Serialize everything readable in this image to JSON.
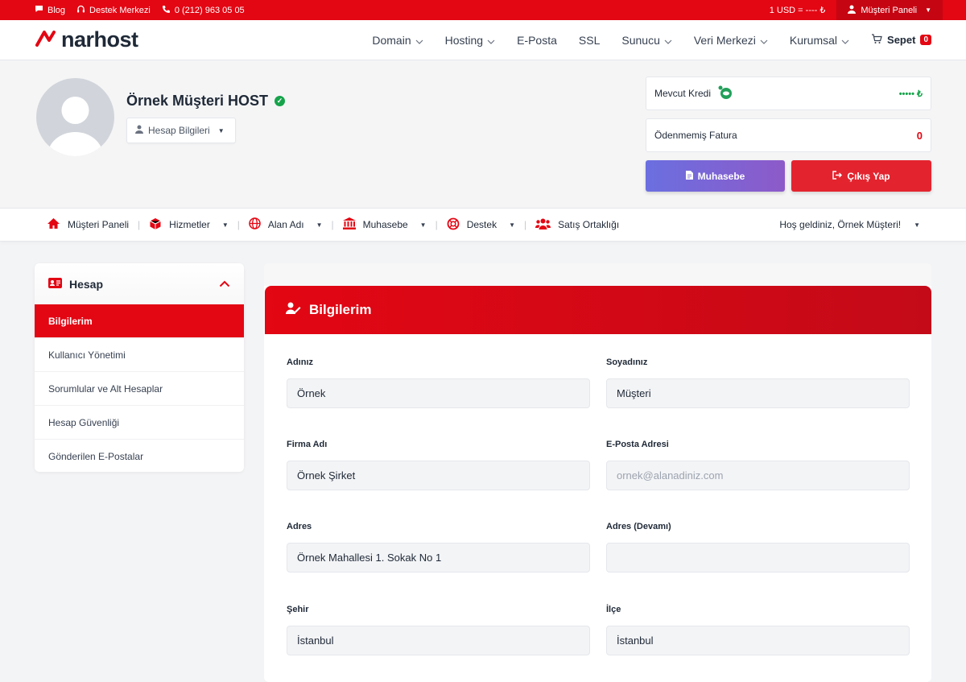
{
  "topbar": {
    "blog": "Blog",
    "support": "Destek Merkezi",
    "phone": "0 (212) 963 05 05",
    "currency": "1 USD = ---- ₺",
    "panel": "Müşteri Paneli"
  },
  "nav": {
    "logo": "narhost",
    "links": [
      "Domain",
      "Hosting",
      "E-Posta",
      "SSL",
      "Sunucu",
      "Veri Merkezi",
      "Kurumsal"
    ],
    "cart_label": "Sepet",
    "cart_count": "0"
  },
  "profile": {
    "name": "Örnek Müşteri HOST",
    "account_button": "Hesap Bilgileri",
    "credit_label": "Mevcut Kredi",
    "credit_value": "••••• ₺",
    "unpaid_label": "Ödenmemiş Fatura",
    "unpaid_value": "0",
    "accounting_button": "Muhasebe",
    "logout_button": "Çıkış Yap"
  },
  "secnav": {
    "items": [
      "Müşteri Paneli",
      "Hizmetler",
      "Alan Adı",
      "Muhasebe",
      "Destek",
      "Satış Ortaklığı"
    ],
    "welcome": "Hoş geldiniz, Örnek Müşteri!"
  },
  "sidebar": {
    "title": "Hesap",
    "items": [
      "Bilgilerim",
      "Kullanıcı Yönetimi",
      "Sorumlular ve Alt Hesaplar",
      "Hesap Güvenliği",
      "Gönderilen E-Postalar"
    ]
  },
  "form": {
    "title": "Bilgilerim",
    "first_name_label": "Adınız",
    "first_name": "Örnek",
    "last_name_label": "Soyadınız",
    "last_name": "Müşteri",
    "company_label": "Firma Adı",
    "company": "Örnek Şirket",
    "email_label": "E-Posta Adresi",
    "email_placeholder": "ornek@alanadiniz.com",
    "address_label": "Adres",
    "address": "Örnek Mahallesi 1. Sokak No 1",
    "address2_label": "Adres (Devamı)",
    "address2": "",
    "city_label": "Şehir",
    "city": "İstanbul",
    "district_label": "İlçe",
    "district": "İstanbul"
  },
  "colors": {
    "brand_red": "#e30613",
    "accounting_gradient": "#6b6fe0",
    "success_green": "#16a34a"
  }
}
